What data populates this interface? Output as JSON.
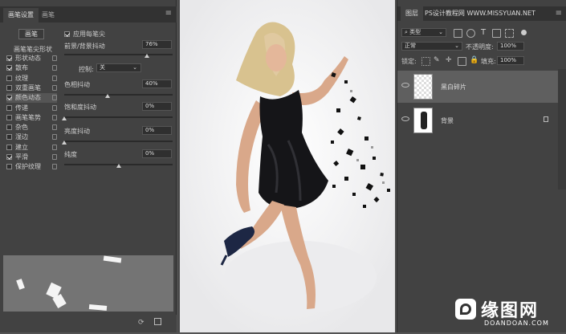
{
  "left_panel": {
    "tabs": [
      "画笔设置",
      "画笔"
    ],
    "brush_button": "画笔",
    "brush_tip_shape": "画笔笔尖形状",
    "categories": [
      {
        "label": "形状动态",
        "checked": true
      },
      {
        "label": "散布",
        "checked": true
      },
      {
        "label": "纹理",
        "checked": false
      },
      {
        "label": "双重画笔",
        "checked": false
      },
      {
        "label": "颜色动态",
        "checked": true
      },
      {
        "label": "传递",
        "checked": false
      },
      {
        "label": "画笔笔势",
        "checked": false
      },
      {
        "label": "杂色",
        "checked": false
      },
      {
        "label": "湿边",
        "checked": false
      },
      {
        "label": "建立",
        "checked": false
      },
      {
        "label": "平滑",
        "checked": true
      },
      {
        "label": "保护纹理",
        "checked": false
      }
    ],
    "apply_per_tip": "应用每笔尖",
    "fg_bg_jitter": {
      "label": "前景/背景抖动",
      "value": "76%"
    },
    "control": {
      "label": "控制:",
      "value": "关"
    },
    "hue_jitter": {
      "label": "色相抖动",
      "value": "40%"
    },
    "saturation_jitter": {
      "label": "饱和度抖动",
      "value": "0%"
    },
    "brightness_jitter": {
      "label": "亮度抖动",
      "value": "0%"
    },
    "purity": {
      "label": "纯度",
      "value": "0%"
    },
    "slider_levels": {
      "fg_bg": 0.76,
      "hue": 0.4,
      "saturation": 0.0,
      "brightness": 0.0,
      "purity": 0.5
    }
  },
  "right_panel": {
    "tab": "图层",
    "watermark_text": "PS设计教程网 WWW.MISSYUAN.NET",
    "kind_filter": "类型",
    "blend_mode": "正常",
    "opacity_label": "不透明度:",
    "opacity_value": "100%",
    "lock_label": "锁定:",
    "fill_label": "填充:",
    "fill_value": "100%",
    "layers": [
      {
        "name": "黑白碎片",
        "selected": true
      },
      {
        "name": "背景",
        "selected": false
      }
    ]
  },
  "watermark": {
    "main": "缘图网",
    "sub": "DOANDOAN.COM"
  },
  "colors": {
    "panel": "#424242",
    "selected_layer": "#5f5f5f",
    "canvas_bg": "#ffffff"
  }
}
